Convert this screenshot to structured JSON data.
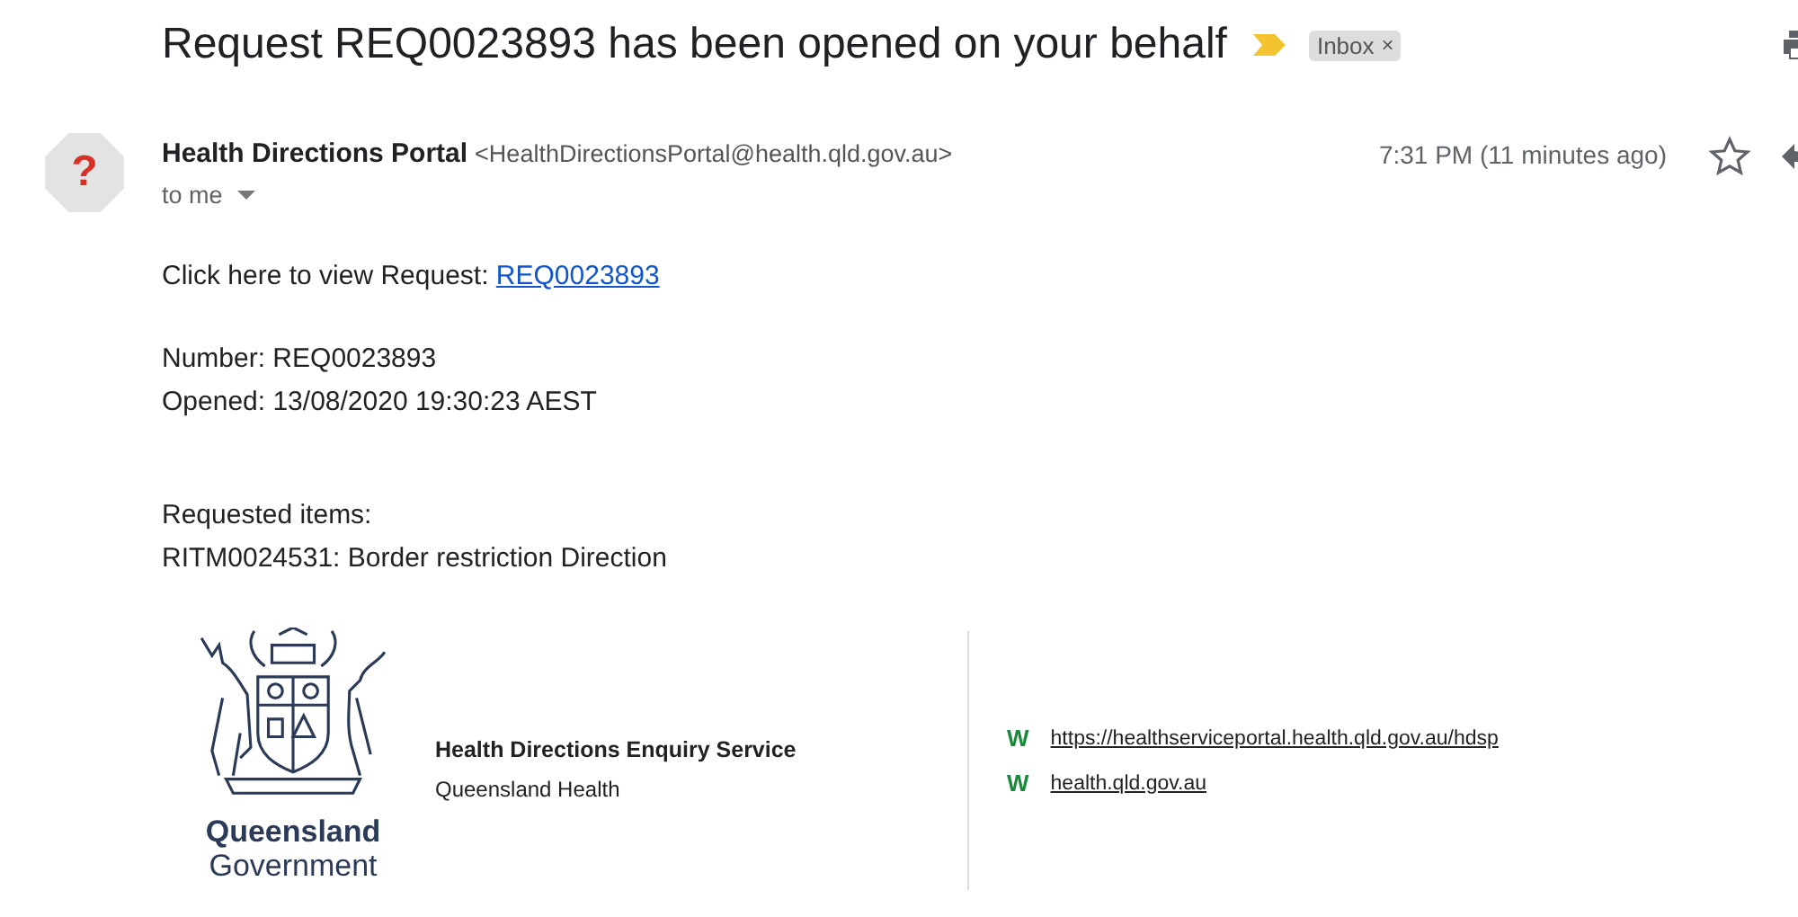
{
  "subject": "Request REQ0023893 has been opened on your behalf",
  "important": true,
  "labels": [
    {
      "text": "Inbox",
      "close": "×"
    }
  ],
  "sender": {
    "avatar": "?",
    "name": "Health Directions Portal",
    "email": "<HealthDirectionsPortal@health.qld.gov.au>",
    "recipient": "to me",
    "time": "7:31 PM (11 minutes ago)",
    "starred": false
  },
  "body": {
    "view_line": {
      "text": "Click here to view Request: ",
      "link": "REQ0023893"
    },
    "details": [
      "Number: REQ0023893",
      "Opened: 13/08/2020 19:30:23 AEST"
    ],
    "items_heading": "Requested items:",
    "items": [
      "RITM0024531: Border restriction Direction"
    ]
  },
  "signature": {
    "logo_text": [
      "Queensland",
      "Government"
    ],
    "title": "Health Directions Enquiry Service",
    "subtitle": "Queensland Health",
    "web": [
      {
        "marker": "W",
        "url": "https://healthserviceportal.health.qld.gov.au/hdsp"
      },
      {
        "marker": "W",
        "url": "health.qld.gov.au"
      }
    ]
  }
}
